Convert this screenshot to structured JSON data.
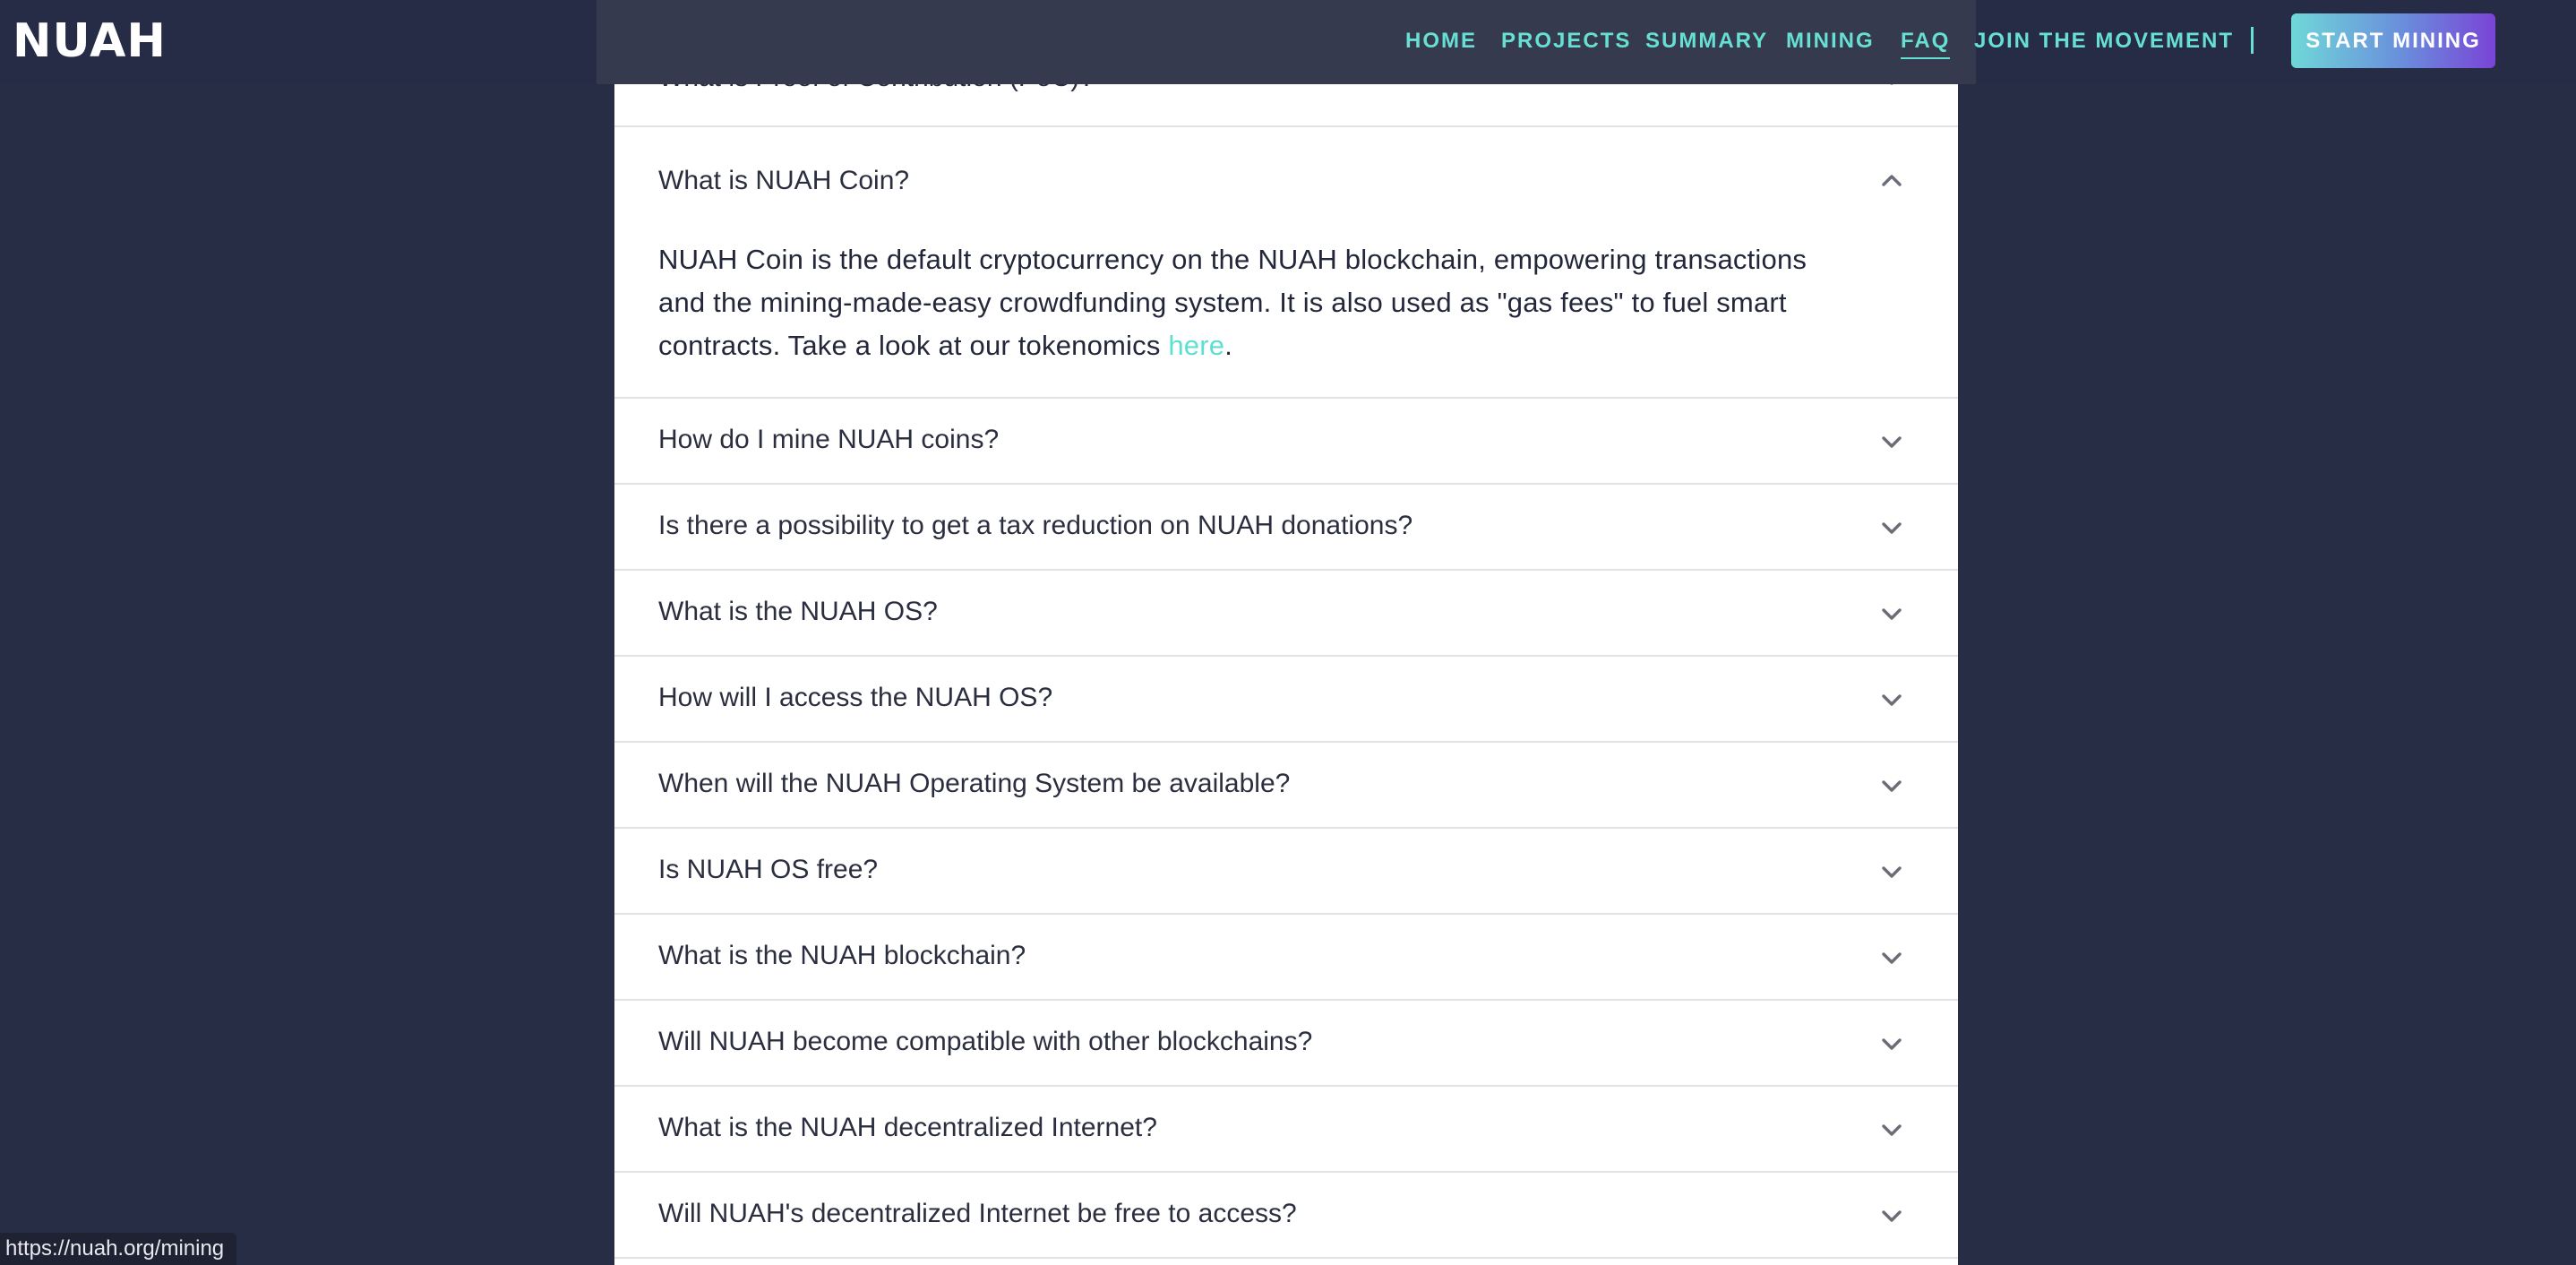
{
  "header": {
    "logo_text": "NUAH",
    "nav": [
      {
        "label": "HOME"
      },
      {
        "label": "PROJECTS"
      },
      {
        "label": "SUMMARY"
      },
      {
        "label": "MINING"
      },
      {
        "label": "FAQ"
      },
      {
        "label": "JOIN THE MOVEMENT"
      }
    ],
    "cta_label": "START MINING"
  },
  "faq": {
    "peek_questions": [
      "What is Proof of Contribution (PoC)?"
    ],
    "expanded": {
      "question": "What is NUAH Coin?",
      "answer_line1": "NUAH Coin is the default cryptocurrency on the NUAH blockchain, empowering transactions",
      "answer_line2": "and the mining-made-easy crowdfunding system. It is also used as \"gas fees\" to fuel smart",
      "answer_line3_prefix": "contracts. Take a look at our tokenomics ",
      "answer_link": "here",
      "answer_line3_suffix": "."
    },
    "questions": [
      "How do I mine NUAH coins?",
      "Is there a possibility to get a tax reduction on NUAH donations?",
      "What is the NUAH OS?",
      "How will I access the NUAH OS?",
      "When will the NUAH Operating System be available?",
      "Is NUAH OS free?",
      "What is the NUAH blockchain?",
      "Will NUAH become compatible with other blockchains?",
      "What is the NUAH decentralized Internet?",
      "Will NUAH's decentralized Internet be free to access?"
    ]
  },
  "status_bar": {
    "url": "https://nuah.org/mining"
  },
  "icons": {
    "expanded": "chevron-up-icon",
    "collapsed": "chevron-down-icon"
  },
  "colors": {
    "page_background": "#272d45",
    "accent": "#67e0d3",
    "link": "#5de0d2",
    "cta_gradient_start": "#6fd8d8",
    "cta_gradient_end": "#7a44d6"
  }
}
